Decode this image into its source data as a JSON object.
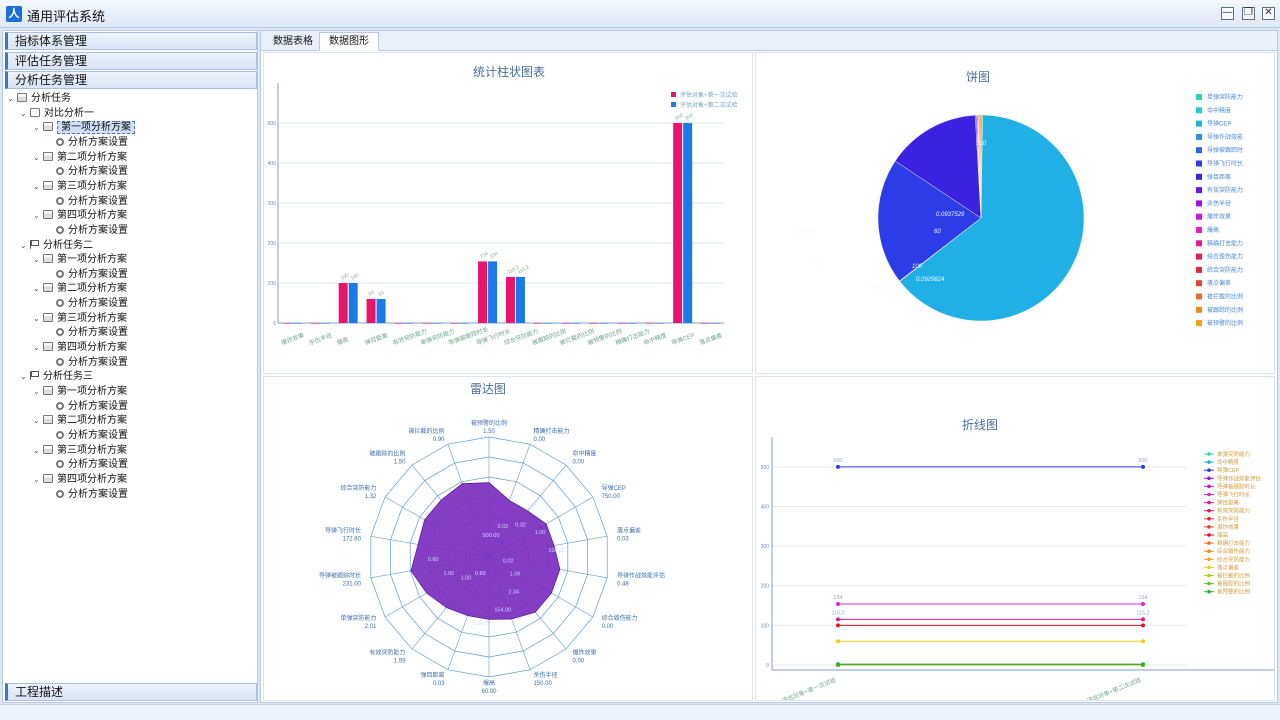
{
  "app": {
    "title": "通用评估系统",
    "logo_glyph": "人"
  },
  "window_controls": {
    "minimize": "—",
    "restore": "❐",
    "close": "✕"
  },
  "left_panel": {
    "sections": [
      "指标体系管理",
      "评估任务管理",
      "分析任务管理"
    ],
    "bottom_section": "工程描述",
    "tree_root": "分析任务",
    "tree": [
      {
        "label": "对比分析一",
        "icon": "flag-icon",
        "children": [
          "第一项分析方案",
          "第二项分析方案",
          "第三项分析方案",
          "第四项分析方案"
        ]
      },
      {
        "label": "分析任务二",
        "icon": "flag-icon",
        "children": [
          "第一项分析方案",
          "第二项分析方案",
          "第三项分析方案",
          "第四项分析方案"
        ]
      },
      {
        "label": "分析任务三",
        "icon": "flag-icon",
        "children": [
          "第一项分析方案",
          "第二项分析方案",
          "第三项分析方案",
          "第四项分析方案"
        ]
      }
    ],
    "setting_label": "分析方案设置",
    "selected_item": "第一项分析方案"
  },
  "tabs": [
    {
      "label": "数据表格",
      "active": false
    },
    {
      "label": "数据图形",
      "active": true
    }
  ],
  "colors": {
    "series1": "#e8156f",
    "series2": "#1a7ae8",
    "radar_fill": "#7b2cbf",
    "axis": "#7fa2c8",
    "grid": "#e3e8ef",
    "title": "#4a6f9a"
  },
  "chart_data": [
    {
      "type": "bar",
      "title": "统计柱状图表",
      "categories": [
        "爆炸效果",
        "杀伤半径",
        "爆高",
        "弹目距离",
        "有效突防能力",
        "单弹突防能力",
        "导弹被跟踪时长",
        "导弹飞行时长",
        "综合突防能力",
        "被跟踪的比例",
        "被拦截的比例",
        "被预警的比例",
        "精确打击能力",
        "命中精度",
        "导弹CEP",
        "落点偏差"
      ],
      "series": [
        {
          "name": "评估对象+第一次试验",
          "values": [
            0,
            0,
            100,
            60,
            0,
            0,
            0,
            154,
            115.2,
            0,
            0,
            0,
            0,
            0,
            500,
            0
          ]
        },
        {
          "name": "评估对象+第二次试验",
          "values": [
            0,
            0,
            100,
            60,
            0,
            0,
            0,
            154,
            115.2,
            0,
            0,
            0,
            0,
            0,
            500,
            0
          ]
        }
      ],
      "ylim": [
        0,
        600
      ],
      "yticks": [
        0,
        100,
        200,
        300,
        400,
        500
      ]
    },
    {
      "type": "pie",
      "title": "饼图",
      "labels": [
        "单弹突防能力",
        "命中精度",
        "导弹CEP",
        "导弹作战效能",
        "导弹被跟踪时",
        "导弹飞行时长",
        "弹目距离",
        "有效突防能力",
        "杀伤半径",
        "爆炸效果",
        "爆高",
        "精确打击能力",
        "综合毁伤能力",
        "综合突防能力",
        "落点偏差",
        "被拦截的比例",
        "被跟踪的比例",
        "被预警的比例"
      ],
      "values": [
        2.01,
        0,
        500,
        0.48,
        0.315024,
        154,
        115.2,
        1.59,
        0,
        0,
        0.093529,
        0,
        0,
        1.32,
        0.03,
        0.9,
        1.5,
        1.5
      ],
      "colors": [
        "#2dd5b8",
        "#25c7d6",
        "#21b0e6",
        "#2e8ee8",
        "#2f63e8",
        "#2c3ce6",
        "#3a22e0",
        "#6a18e4",
        "#9b12e8",
        "#c815e0",
        "#e421c9",
        "#e4188f",
        "#e41a5a",
        "#e2283b",
        "#e3462a",
        "#e86d25",
        "#ec8a20",
        "#f2a019"
      ],
      "slice_labels": [
        "500",
        "0.315024",
        "154",
        "115.2",
        "0.0929824",
        "100",
        "60",
        "0.0937529"
      ]
    },
    {
      "type": "radar",
      "title": "雷达图",
      "axes": [
        "被预警的比例",
        "精确打击能力",
        "命中精度",
        "导弹CEP",
        "落点偏差",
        "导弹作战效能评估",
        "综合毁伤能力",
        "爆炸效果",
        "杀伤半径",
        "爆高",
        "弹目距离",
        "有效突防能力",
        "单弹突防能力",
        "导弹被跟踪时长",
        "导弹飞行时长",
        "综合突防能力",
        "被跟踪的比例",
        "被拦截的比例"
      ],
      "values": [
        "1.50",
        "0.00",
        "0.00",
        "750.00",
        "0.03",
        "0.48",
        "0.00",
        "0.00",
        "150.00",
        "60.00",
        "0.03",
        "1.59",
        "2.01",
        "231.00",
        "172.80",
        "1.32",
        "1.50",
        "0.90"
      ],
      "ring_ticks": [
        "1.00",
        "0.80",
        "0.60",
        "0.40",
        "0.20",
        "0.00"
      ],
      "center_labels": [
        "500.00",
        "0.02",
        "0.32",
        "1.00",
        "100.00",
        "0.02",
        "1.06",
        "2.34",
        "154.00",
        "115.20",
        "0.88",
        "1.00",
        "1.00",
        "0.60"
      ]
    },
    {
      "type": "line",
      "title": "折线图",
      "x": [
        "评估对象+第一次试验",
        "评估对象+第二次试验"
      ],
      "ylim": [
        0,
        550
      ],
      "yticks": [
        0,
        100,
        200,
        300,
        400,
        500
      ],
      "series": [
        {
          "name": "单弹突防能力",
          "values": [
            2.01,
            2.01
          ],
          "color": "#2dd5b8"
        },
        {
          "name": "命中精度",
          "values": [
            0,
            0
          ],
          "color": "#21b0e6"
        },
        {
          "name": "导弹CEP",
          "values": [
            500,
            500
          ],
          "color": "#2c3ce6"
        },
        {
          "name": "导弹作战效能评估",
          "values": [
            0.48,
            0.48
          ],
          "color": "#9b12e8"
        },
        {
          "name": "导弹被跟踪时长",
          "values": [
            0.32,
            0.32
          ],
          "color": "#c815e0"
        },
        {
          "name": "导弹飞行时长",
          "values": [
            154,
            154
          ],
          "color": "#e421c9"
        },
        {
          "name": "弹目距离",
          "values": [
            115.2,
            115.2
          ],
          "color": "#e4188f"
        },
        {
          "name": "有效突防能力",
          "values": [
            1.59,
            1.59
          ],
          "color": "#e41a5a"
        },
        {
          "name": "杀伤半径",
          "values": [
            0,
            0
          ],
          "color": "#e2283b"
        },
        {
          "name": "爆炸效果",
          "values": [
            0,
            0
          ],
          "color": "#e3462a"
        },
        {
          "name": "爆高",
          "values": [
            100,
            100
          ],
          "color": "#e41020"
        },
        {
          "name": "精确打击能力",
          "values": [
            0,
            0
          ],
          "color": "#e86d25"
        },
        {
          "name": "综合毁伤能力",
          "values": [
            0,
            0
          ],
          "color": "#ec8a20"
        },
        {
          "name": "综合突防能力",
          "values": [
            1.32,
            1.32
          ],
          "color": "#f2a019"
        },
        {
          "name": "落点偏差",
          "values": [
            60,
            60
          ],
          "color": "#e7d21b"
        },
        {
          "name": "被拦截的比例",
          "values": [
            0.9,
            0.9
          ],
          "color": "#a9d41f"
        },
        {
          "name": "被跟踪的比例",
          "values": [
            1.5,
            1.5
          ],
          "color": "#5cc422"
        },
        {
          "name": "被预警的比例",
          "values": [
            1.5,
            1.5
          ],
          "color": "#25b52c"
        }
      ],
      "point_labels": [
        "500",
        "154",
        "115.2",
        "500",
        "154",
        "115.2"
      ]
    }
  ]
}
